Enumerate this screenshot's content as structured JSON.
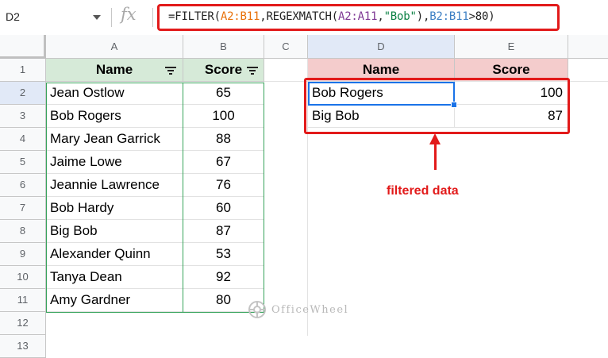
{
  "name_box": {
    "value": "D2"
  },
  "formula_bar": {
    "fx_label": "fx",
    "parts": [
      "=FILTER(",
      "A2:B11",
      ",REGEXMATCH(",
      "A2:A11",
      ",",
      "\"Bob\"",
      "),",
      "B2:B11",
      ">80)"
    ]
  },
  "columns": [
    "A",
    "B",
    "C",
    "D",
    "E"
  ],
  "rows": [
    "1",
    "2",
    "3",
    "4",
    "5",
    "6",
    "7",
    "8",
    "9",
    "10",
    "11",
    "12",
    "13"
  ],
  "source_table": {
    "headers": [
      "Name",
      "Score"
    ],
    "rows": [
      [
        "Jean Ostlow",
        "65"
      ],
      [
        "Bob Rogers",
        "100"
      ],
      [
        "Mary Jean Garrick",
        "88"
      ],
      [
        "Jaime Lowe",
        "67"
      ],
      [
        "Jeannie Lawrence",
        "76"
      ],
      [
        "Bob Hardy",
        "60"
      ],
      [
        "Big Bob",
        "87"
      ],
      [
        "Alexander Quinn",
        "53"
      ],
      [
        "Tanya Dean",
        "92"
      ],
      [
        "Amy Gardner",
        "80"
      ]
    ]
  },
  "result_table": {
    "headers": [
      "Name",
      "Score"
    ],
    "rows": [
      [
        "Bob Rogers",
        "100"
      ],
      [
        "Big Bob",
        "87"
      ]
    ]
  },
  "annotation": {
    "caption": "filtered data"
  },
  "watermark": {
    "text": "OfficeWheel"
  },
  "colors": {
    "highlight_red": "#e21a1a",
    "header_green": "#d6ead8",
    "header_pink": "#f4cccc",
    "selection_blue": "#1a73e8"
  }
}
